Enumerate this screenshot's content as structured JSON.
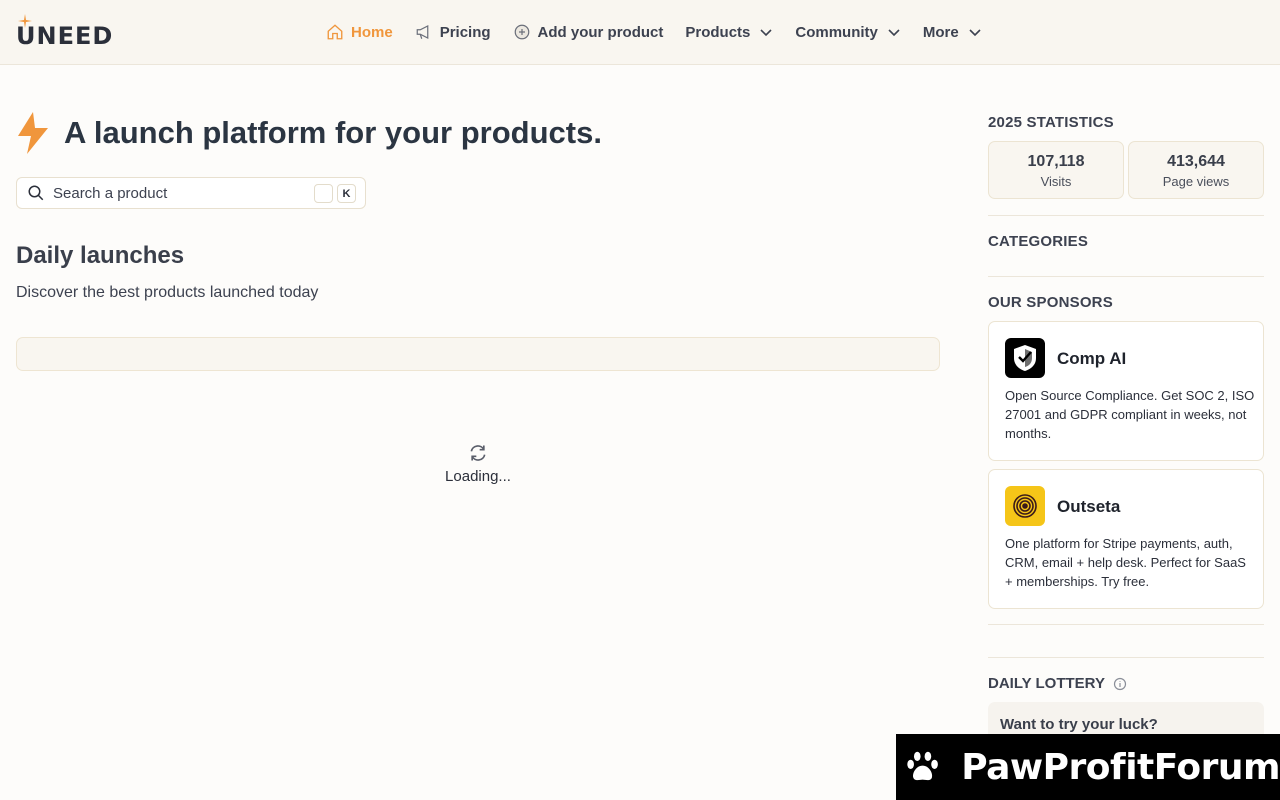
{
  "header": {
    "logo_text": "UNEED",
    "nav": [
      {
        "label": "Home",
        "icon": "home-icon",
        "active": true
      },
      {
        "label": "Pricing",
        "icon": "megaphone-icon"
      },
      {
        "label": "Add your product",
        "icon": "plus-circle-icon"
      },
      {
        "label": "Products",
        "dropdown": true
      },
      {
        "label": "Community",
        "dropdown": true
      },
      {
        "label": "More",
        "dropdown": true
      }
    ]
  },
  "hero": {
    "title": "A launch platform for your products.",
    "icon": "lightning-bolt-icon"
  },
  "search": {
    "placeholder": "Search a product",
    "shortcut_key": "K"
  },
  "daily": {
    "title": "Daily launches",
    "subtitle": "Discover the best products launched today"
  },
  "loading": {
    "text": "Loading..."
  },
  "sidebar": {
    "stats_title": "2025 STATISTICS",
    "stats": [
      {
        "value": "107,118",
        "label": "Visits"
      },
      {
        "value": "413,644",
        "label": "Page views"
      }
    ],
    "categories_title": "CATEGORIES",
    "sponsors_title": "OUR SPONSORS",
    "sponsors": [
      {
        "name": "Comp AI",
        "description": "Open Source Compliance. Get SOC 2, ISO 27001 and GDPR compliant in weeks, not months.",
        "logo": "shield-check-icon",
        "color": "#000000"
      },
      {
        "name": "Outseta",
        "description": "One platform for Stripe payments, auth, CRM, email + help desk. Perfect for SaaS + memberships. Try free.",
        "logo": "target-rings-icon",
        "color": "#f5c518"
      }
    ],
    "lottery_title": "DAILY LOTTERY",
    "lottery_question": "Want to try your luck?"
  },
  "watermark": {
    "text": "PawProfitForum"
  },
  "colors": {
    "accent": "#f0963c",
    "text": "#2b2f3a",
    "header_bg": "#f9f6f0"
  }
}
